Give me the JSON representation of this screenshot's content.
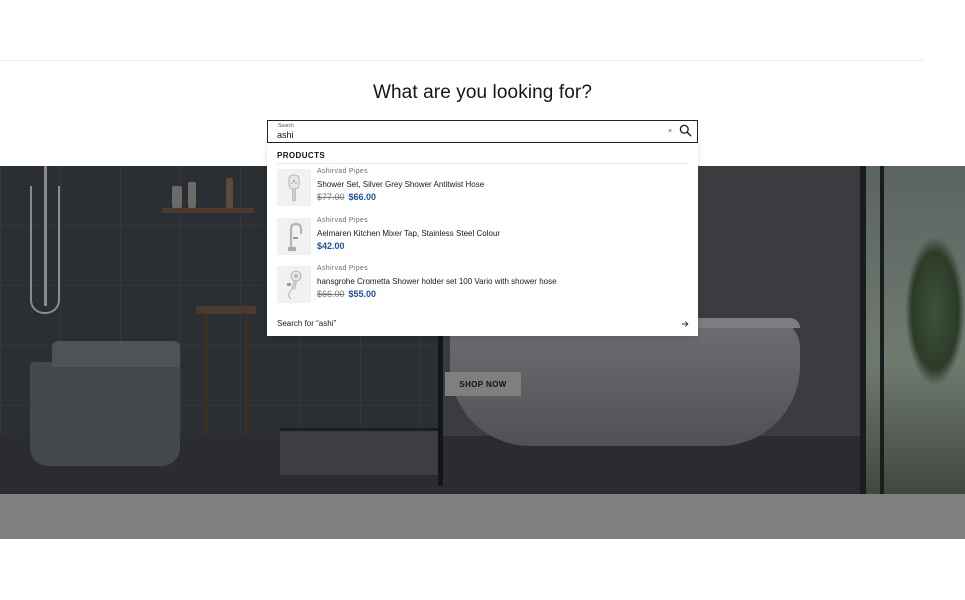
{
  "search": {
    "heading": "What are you looking for?",
    "float_label": "Search",
    "query": "ashi",
    "clear_symbol": "×"
  },
  "suggestions": {
    "products_heading": "PRODUCTS",
    "items": [
      {
        "vendor": "Ashirvad Pipes",
        "title": "Shower Set, Silver Grey Shower Antitwist Hose",
        "compare_price": "$77.00",
        "price": "$66.00",
        "thumb_icon": "shower-head-icon"
      },
      {
        "vendor": "Ashirvad Pipes",
        "title": "Aelmaren Kitchen Mixer Tap, Stainless Steel Colour",
        "compare_price": "",
        "price": "$42.00",
        "thumb_icon": "mixer-tap-icon"
      },
      {
        "vendor": "Ashirvad Pipes",
        "title": "hansgrohe Crometta Shower holder set 100 Vario with shower hose",
        "compare_price": "$66.00",
        "price": "$55.00",
        "thumb_icon": "shower-holder-icon"
      }
    ],
    "search_for": "Search for “ashi”"
  },
  "hero": {
    "button_label": "SHOP NOW"
  },
  "colors": {
    "sale_price": "#1e4f9c",
    "hero_overlay": "#2b2e31",
    "button_bg": "#7f7f7f"
  }
}
